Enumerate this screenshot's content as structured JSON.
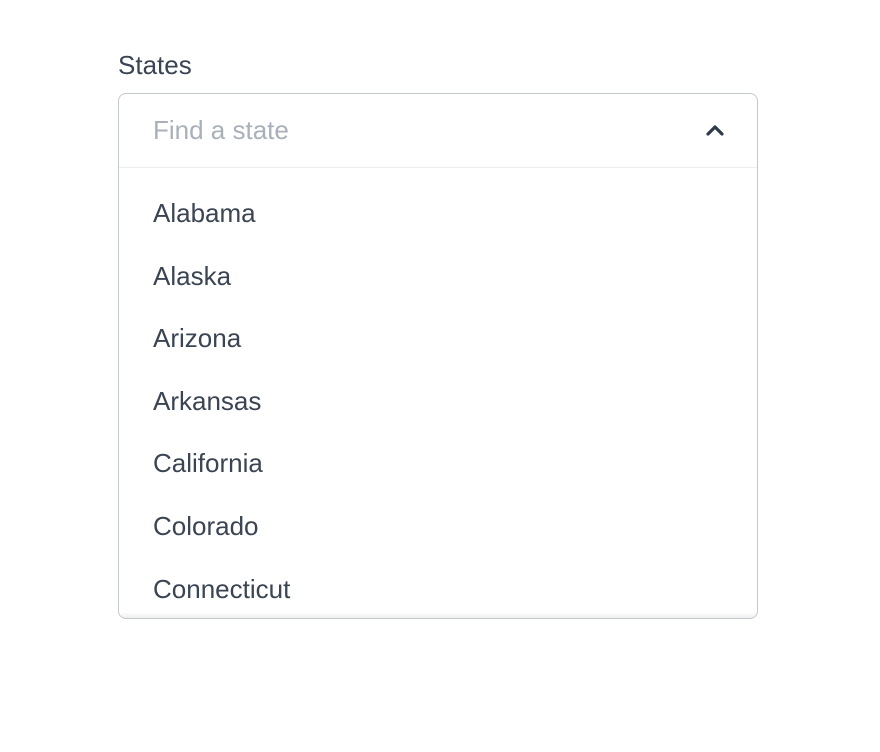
{
  "label": "States",
  "search": {
    "placeholder": "Find a state",
    "value": ""
  },
  "options": [
    "Alabama",
    "Alaska",
    "Arizona",
    "Arkansas",
    "California",
    "Colorado",
    "Connecticut"
  ]
}
